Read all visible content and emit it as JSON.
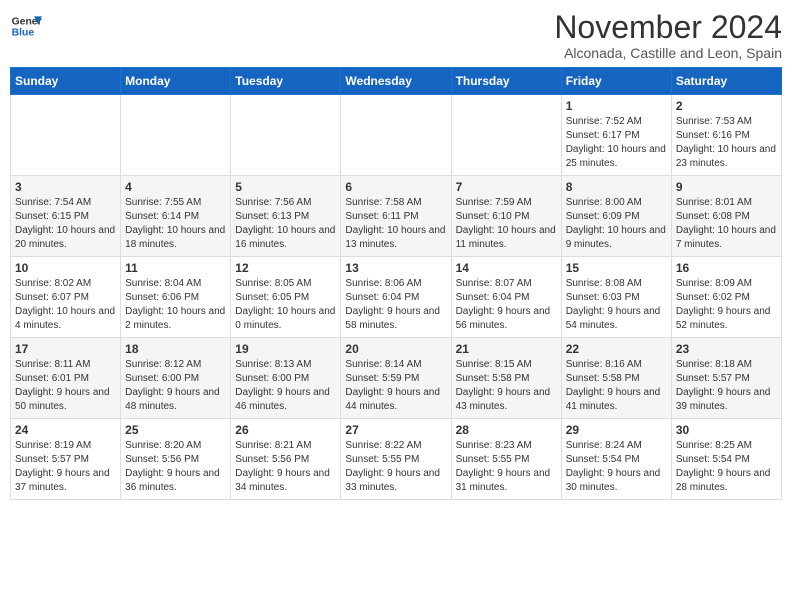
{
  "header": {
    "logo": {
      "general": "General",
      "blue": "Blue"
    },
    "title": "November 2024",
    "location": "Alconada, Castille and Leon, Spain"
  },
  "days_of_week": [
    "Sunday",
    "Monday",
    "Tuesday",
    "Wednesday",
    "Thursday",
    "Friday",
    "Saturday"
  ],
  "weeks": [
    [
      {
        "day": "",
        "info": ""
      },
      {
        "day": "",
        "info": ""
      },
      {
        "day": "",
        "info": ""
      },
      {
        "day": "",
        "info": ""
      },
      {
        "day": "",
        "info": ""
      },
      {
        "day": "1",
        "info": "Sunrise: 7:52 AM\nSunset: 6:17 PM\nDaylight: 10 hours and 25 minutes."
      },
      {
        "day": "2",
        "info": "Sunrise: 7:53 AM\nSunset: 6:16 PM\nDaylight: 10 hours and 23 minutes."
      }
    ],
    [
      {
        "day": "3",
        "info": "Sunrise: 7:54 AM\nSunset: 6:15 PM\nDaylight: 10 hours and 20 minutes."
      },
      {
        "day": "4",
        "info": "Sunrise: 7:55 AM\nSunset: 6:14 PM\nDaylight: 10 hours and 18 minutes."
      },
      {
        "day": "5",
        "info": "Sunrise: 7:56 AM\nSunset: 6:13 PM\nDaylight: 10 hours and 16 minutes."
      },
      {
        "day": "6",
        "info": "Sunrise: 7:58 AM\nSunset: 6:11 PM\nDaylight: 10 hours and 13 minutes."
      },
      {
        "day": "7",
        "info": "Sunrise: 7:59 AM\nSunset: 6:10 PM\nDaylight: 10 hours and 11 minutes."
      },
      {
        "day": "8",
        "info": "Sunrise: 8:00 AM\nSunset: 6:09 PM\nDaylight: 10 hours and 9 minutes."
      },
      {
        "day": "9",
        "info": "Sunrise: 8:01 AM\nSunset: 6:08 PM\nDaylight: 10 hours and 7 minutes."
      }
    ],
    [
      {
        "day": "10",
        "info": "Sunrise: 8:02 AM\nSunset: 6:07 PM\nDaylight: 10 hours and 4 minutes."
      },
      {
        "day": "11",
        "info": "Sunrise: 8:04 AM\nSunset: 6:06 PM\nDaylight: 10 hours and 2 minutes."
      },
      {
        "day": "12",
        "info": "Sunrise: 8:05 AM\nSunset: 6:05 PM\nDaylight: 10 hours and 0 minutes."
      },
      {
        "day": "13",
        "info": "Sunrise: 8:06 AM\nSunset: 6:04 PM\nDaylight: 9 hours and 58 minutes."
      },
      {
        "day": "14",
        "info": "Sunrise: 8:07 AM\nSunset: 6:04 PM\nDaylight: 9 hours and 56 minutes."
      },
      {
        "day": "15",
        "info": "Sunrise: 8:08 AM\nSunset: 6:03 PM\nDaylight: 9 hours and 54 minutes."
      },
      {
        "day": "16",
        "info": "Sunrise: 8:09 AM\nSunset: 6:02 PM\nDaylight: 9 hours and 52 minutes."
      }
    ],
    [
      {
        "day": "17",
        "info": "Sunrise: 8:11 AM\nSunset: 6:01 PM\nDaylight: 9 hours and 50 minutes."
      },
      {
        "day": "18",
        "info": "Sunrise: 8:12 AM\nSunset: 6:00 PM\nDaylight: 9 hours and 48 minutes."
      },
      {
        "day": "19",
        "info": "Sunrise: 8:13 AM\nSunset: 6:00 PM\nDaylight: 9 hours and 46 minutes."
      },
      {
        "day": "20",
        "info": "Sunrise: 8:14 AM\nSunset: 5:59 PM\nDaylight: 9 hours and 44 minutes."
      },
      {
        "day": "21",
        "info": "Sunrise: 8:15 AM\nSunset: 5:58 PM\nDaylight: 9 hours and 43 minutes."
      },
      {
        "day": "22",
        "info": "Sunrise: 8:16 AM\nSunset: 5:58 PM\nDaylight: 9 hours and 41 minutes."
      },
      {
        "day": "23",
        "info": "Sunrise: 8:18 AM\nSunset: 5:57 PM\nDaylight: 9 hours and 39 minutes."
      }
    ],
    [
      {
        "day": "24",
        "info": "Sunrise: 8:19 AM\nSunset: 5:57 PM\nDaylight: 9 hours and 37 minutes."
      },
      {
        "day": "25",
        "info": "Sunrise: 8:20 AM\nSunset: 5:56 PM\nDaylight: 9 hours and 36 minutes."
      },
      {
        "day": "26",
        "info": "Sunrise: 8:21 AM\nSunset: 5:56 PM\nDaylight: 9 hours and 34 minutes."
      },
      {
        "day": "27",
        "info": "Sunrise: 8:22 AM\nSunset: 5:55 PM\nDaylight: 9 hours and 33 minutes."
      },
      {
        "day": "28",
        "info": "Sunrise: 8:23 AM\nSunset: 5:55 PM\nDaylight: 9 hours and 31 minutes."
      },
      {
        "day": "29",
        "info": "Sunrise: 8:24 AM\nSunset: 5:54 PM\nDaylight: 9 hours and 30 minutes."
      },
      {
        "day": "30",
        "info": "Sunrise: 8:25 AM\nSunset: 5:54 PM\nDaylight: 9 hours and 28 minutes."
      }
    ]
  ]
}
